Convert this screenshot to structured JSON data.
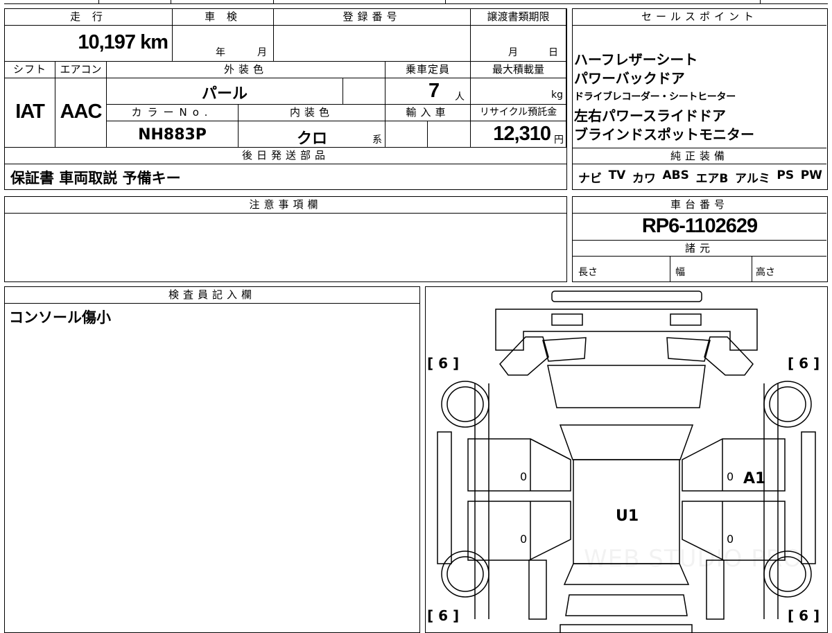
{
  "main_table": {
    "mileage_header": "走 行",
    "mileage_value": "10,197 km",
    "inspection_header": "車 検",
    "inspection_year_unit": "年",
    "inspection_month_unit": "月",
    "registration_header": "登録番号",
    "transfer_deadline_header": "譲渡書類期限",
    "transfer_month_unit": "月",
    "transfer_day_unit": "日",
    "shift_header": "シフト",
    "aircon_header": "エアコン",
    "exterior_color_header": "外装色",
    "capacity_header": "乗車定員",
    "max_load_header": "最大積載量",
    "shift_value": "IAT",
    "aircon_value": "AAC",
    "exterior_color_value": "パール",
    "capacity_value": "7",
    "capacity_unit": "人",
    "max_load_unit": "kg",
    "color_no_header": "カラーNo.",
    "interior_color_header": "内装色",
    "import_header": "輸入車",
    "recycle_header": "リサイクル預託金",
    "color_no_value": "NH883P",
    "interior_color_value": "クロ",
    "interior_color_suffix": "系",
    "recycle_value": "12,310",
    "recycle_unit": "円",
    "later_parts_header": "後日発送部品",
    "later_parts_value": "保証書 車両取説 予備キー"
  },
  "sales_points": {
    "header": "セールスポイント",
    "items": [
      "ハーフレザーシート",
      "パワーバックドア",
      "ドライブレコーダー・シートヒーター",
      "左右パワースライドドア",
      "ブラインドスポットモニター"
    ]
  },
  "standard_equipment": {
    "header": "純正装備",
    "items": [
      "ナビ",
      "TV",
      "カワ",
      "ABS",
      "エアB",
      "アルミ",
      "PS",
      "PW"
    ]
  },
  "notes": {
    "header": "注意事項欄"
  },
  "chassis": {
    "header": "車台番号",
    "value": "RP6-1102629"
  },
  "specs": {
    "header": "諸元",
    "length_label": "長さ",
    "width_label": "幅",
    "height_label": "高さ"
  },
  "inspector": {
    "header": "検査員記入欄",
    "comment": "コンソール傷小"
  },
  "car_diagram": {
    "tire_front_left": "[ 6 ]",
    "tire_front_right": "[ 6 ]",
    "tire_rear_left": "[ 6 ]",
    "tire_rear_right": "[ 6 ]",
    "door_fl_mark": "0",
    "door_fr_mark": "0",
    "door_rl_mark": "0",
    "door_rr_mark": "0",
    "damage_right_front": "A1",
    "damage_center": "U1",
    "watermark": "WEB STUDIO PRO"
  },
  "colors": {
    "border": "#000000",
    "background": "#ffffff"
  }
}
